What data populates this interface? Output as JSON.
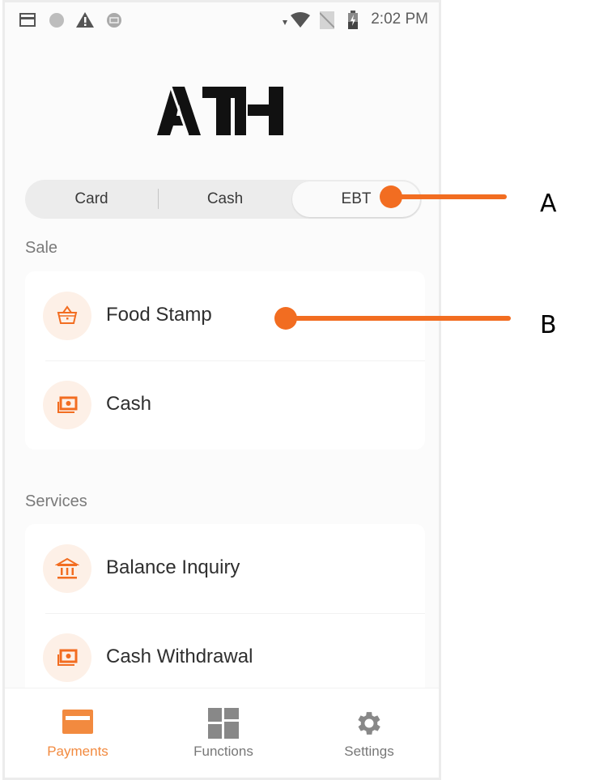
{
  "status_bar": {
    "left_icons": [
      "card-notification-icon",
      "circle-notification-icon",
      "warning-icon",
      "sync-icon"
    ],
    "right_icons": [
      "signal-arrow-icon",
      "wifi-icon",
      "no-sim-icon",
      "battery-charging-icon"
    ],
    "time": "2:02 PM"
  },
  "app": {
    "logo_text": "ATH"
  },
  "segmented": {
    "options": [
      {
        "label": "Card",
        "active": false
      },
      {
        "label": "Cash",
        "active": false
      },
      {
        "label": "EBT",
        "active": true
      }
    ]
  },
  "sections": [
    {
      "title": "Sale",
      "items": [
        {
          "label": "Food Stamp",
          "icon": "basket-icon"
        },
        {
          "label": "Cash",
          "icon": "cash-icon"
        }
      ]
    },
    {
      "title": "Services",
      "items": [
        {
          "label": "Balance Inquiry",
          "icon": "bank-icon"
        },
        {
          "label": "Cash Withdrawal",
          "icon": "cash-icon"
        }
      ]
    }
  ],
  "bottom_nav": {
    "items": [
      {
        "label": "Payments",
        "icon": "payment-card-icon",
        "active": true
      },
      {
        "label": "Functions",
        "icon": "grid-icon",
        "active": false
      },
      {
        "label": "Settings",
        "icon": "gear-icon",
        "active": false
      }
    ]
  },
  "annotations": [
    {
      "label": "A",
      "target": "EBT tab"
    },
    {
      "label": "B",
      "target": "Food Stamp item"
    }
  ],
  "colors": {
    "accent": "#f28a3f",
    "annotation": "#f26d21",
    "icon_bg": "#fdf0e7"
  }
}
